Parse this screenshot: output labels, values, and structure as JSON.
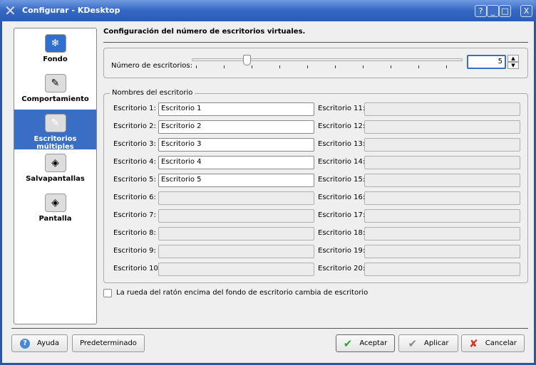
{
  "window": {
    "title": "Configurar - KDesktop",
    "help": "?",
    "minimize": "_",
    "maximize": "□",
    "close": "X"
  },
  "sidebar": {
    "items": [
      {
        "label": "Fondo",
        "icon": "background-icon"
      },
      {
        "label": "Comportamiento",
        "icon": "behavior-icon"
      },
      {
        "label": "Escritorios múltiples",
        "icon": "multiple-desktops-icon",
        "selected": true
      },
      {
        "label": "Salvapantallas",
        "icon": "screensaver-icon"
      },
      {
        "label": "Pantalla",
        "icon": "display-icon"
      }
    ]
  },
  "main": {
    "heading": "Configuración del número de escritorios virtuales.",
    "count_label": "Número de escritorios:",
    "count_value": "5",
    "slider": {
      "min": 1,
      "max": 20,
      "value": 5
    },
    "names_group": "Nombres del escritorio",
    "desktops": [
      {
        "label": "Escritorio 1:",
        "value": "Escritorio 1"
      },
      {
        "label": "Escritorio 2:",
        "value": "Escritorio 2"
      },
      {
        "label": "Escritorio 3:",
        "value": "Escritorio 3"
      },
      {
        "label": "Escritorio 4:",
        "value": "Escritorio 4"
      },
      {
        "label": "Escritorio 5:",
        "value": "Escritorio 5"
      },
      {
        "label": "Escritorio 6:",
        "value": ""
      },
      {
        "label": "Escritorio 7:",
        "value": ""
      },
      {
        "label": "Escritorio 8:",
        "value": ""
      },
      {
        "label": "Escritorio 9:",
        "value": ""
      },
      {
        "label": "Escritorio 10:",
        "value": ""
      },
      {
        "label": "Escritorio 11:",
        "value": ""
      },
      {
        "label": "Escritorio 12:",
        "value": ""
      },
      {
        "label": "Escritorio 13:",
        "value": ""
      },
      {
        "label": "Escritorio 14:",
        "value": ""
      },
      {
        "label": "Escritorio 15:",
        "value": ""
      },
      {
        "label": "Escritorio 16:",
        "value": ""
      },
      {
        "label": "Escritorio 17:",
        "value": ""
      },
      {
        "label": "Escritorio 18:",
        "value": ""
      },
      {
        "label": "Escritorio 19:",
        "value": ""
      },
      {
        "label": "Escritorio 20:",
        "value": ""
      }
    ],
    "wheel_checkbox": {
      "label": "La rueda del ratón encima del fondo de escritorio cambia de escritorio",
      "checked": false
    }
  },
  "buttons": {
    "help": "Ayuda",
    "defaults": "Predeterminado",
    "ok": "Aceptar",
    "apply": "Aplicar",
    "cancel": "Cancelar"
  }
}
